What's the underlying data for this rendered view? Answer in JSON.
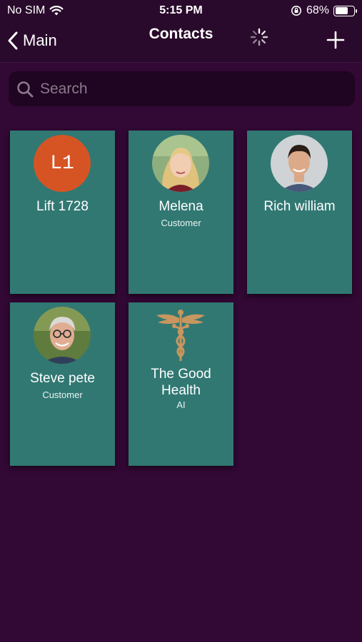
{
  "status_bar": {
    "carrier": "No SIM",
    "time": "5:15 PM",
    "battery": "68%",
    "battery_level": 0.68
  },
  "nav": {
    "back_label": "Main",
    "title": "Contacts"
  },
  "search": {
    "placeholder": "Search",
    "value": ""
  },
  "contacts": [
    {
      "name": "Lift 1728",
      "subtitle": "",
      "avatar": "initials",
      "initials": "L1",
      "avatar_color": "#d65424"
    },
    {
      "name": "Melena",
      "subtitle": "Customer",
      "avatar": "photo-woman-blonde"
    },
    {
      "name": "Rich william",
      "subtitle": "",
      "avatar": "photo-man-dark-hair"
    },
    {
      "name": "Steve pete",
      "subtitle": "Customer",
      "avatar": "photo-man-glasses"
    },
    {
      "name": "The Good Health",
      "subtitle": "AI",
      "avatar": "caduceus-icon",
      "avatar_color": "#c8965e"
    }
  ],
  "colors": {
    "background": "#320834",
    "card": "#317873",
    "search_bg": "#1f0521"
  }
}
